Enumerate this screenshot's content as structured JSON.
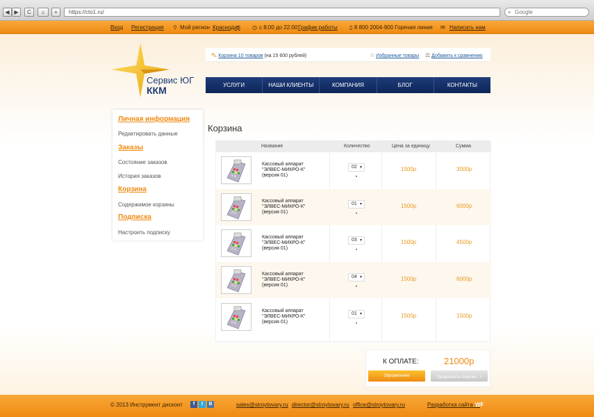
{
  "browser": {
    "url": "https://cto1.ru/",
    "search_placeholder": "Google",
    "back": "◀",
    "forward": "▶",
    "reload": "C",
    "home": "⌂",
    "add": "+"
  },
  "topbar": {
    "login": "Вход",
    "register": "Регистрация",
    "region_label": "Мой регион",
    "region_value": "Краснодар",
    "hours": "с 8:00 до 22:00",
    "schedule": "График работы",
    "phone": "8 800 2004-900 Горячая линия",
    "write_us": "Написать нам"
  },
  "logo": {
    "line1": "Сервис ЮГ",
    "line2": "ККМ"
  },
  "info": {
    "cart_link": "Корзина 10 товаров",
    "cart_total": "(на 15 600 рублей)",
    "favorites": "Избранные товары",
    "compare": "Добавить к сравнению"
  },
  "menu": [
    "УСЛУГИ",
    "НАШИ КЛИЕНТЫ",
    "КОМПАНИЯ",
    "БЛОГ",
    "КОНТАКТЫ"
  ],
  "sidebar": {
    "personal": "Личная информация",
    "edit": "Редактировать данные",
    "orders": "Заказы",
    "order_status": "Состояние заказов",
    "order_history": "История заказов",
    "cart": "Корзина",
    "cart_contents": "Содержимое корзины",
    "subscription": "Подписка",
    "subscription_settings": "Настроить подписку"
  },
  "cart": {
    "title": "Корзина",
    "headers": {
      "name": "Название",
      "qty": "Количество",
      "price": "Цена за единицу",
      "sum": "Сумма"
    },
    "rows": [
      {
        "name": "Кассовый аппарат \"ЭЛВЕС-МИКРО-К\" (версия 01)",
        "qty": "02",
        "price": "1500р",
        "sum": "3000р"
      },
      {
        "name": "Кассовый аппарат \"ЭЛВЕС-МИКРО-К\" (версия 01)",
        "qty": "01",
        "price": "1500р",
        "sum": "6000р"
      },
      {
        "name": "Кассовый аппарат \"ЭЛВЕС-МИКРО-К\" (версия 01)",
        "qty": "03",
        "price": "1500р",
        "sum": "4500р"
      },
      {
        "name": "Кассовый аппарат \"ЭЛВЕС-МИКРО-К\" (версия 01)",
        "qty": "04",
        "price": "1500р",
        "sum": "6000р"
      },
      {
        "name": "Кассовый аппарат \"ЭЛВЕС-МИКРО-К\" (версия 01)",
        "qty": "01",
        "price": "1500р",
        "sum": "1500р"
      }
    ],
    "total_label": "К ОПЛАТЕ:",
    "total_value": "21000р",
    "order_button": "Оформление",
    "continue_button": "Продолжить покупки"
  },
  "footer": {
    "copyright": "© 2013 Инструмент дисконт",
    "social": [
      "f",
      "t",
      "В"
    ],
    "email1": "sales@stroytovary.ru",
    "email2": "director@stroytovary.ru",
    "email3": "office@stroytovary.ru",
    "dev_label": "Разработка сайта —",
    "dev_name": "WF"
  },
  "colors": {
    "accent": "#ee8a12",
    "navy": "#1d3b78",
    "link": "#1d5a9a"
  }
}
